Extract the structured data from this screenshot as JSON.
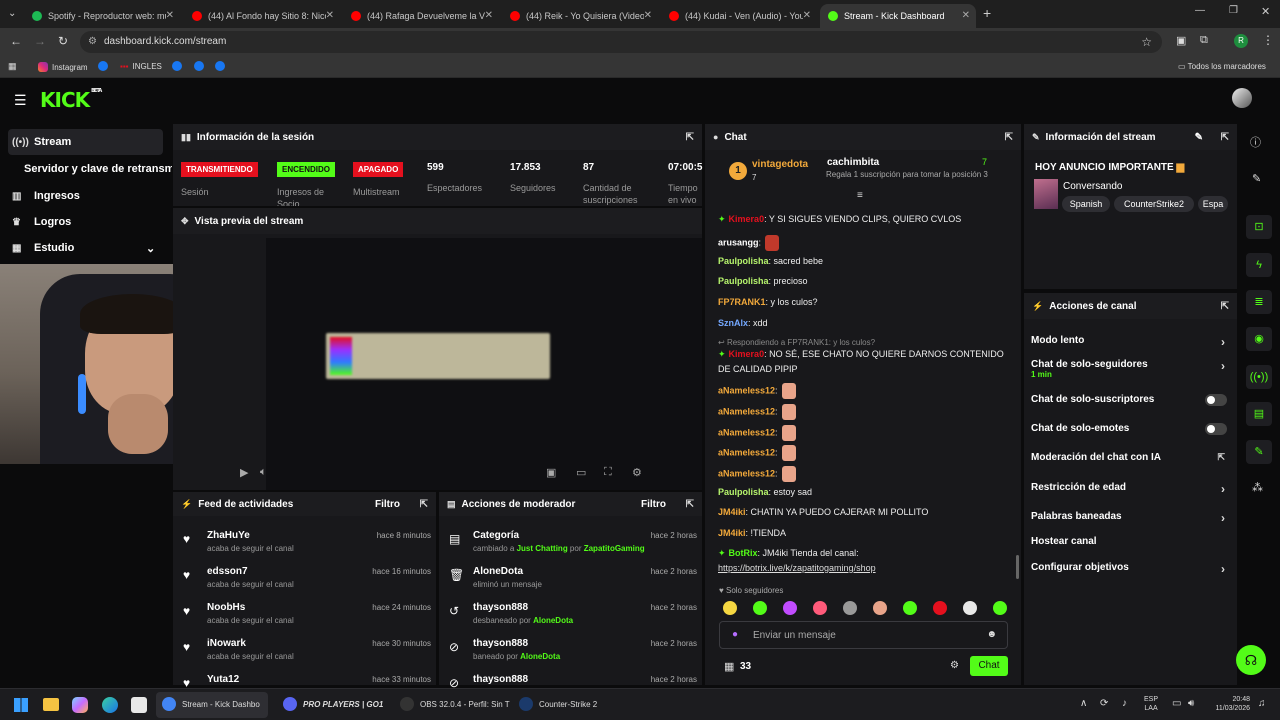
{
  "browser": {
    "tabs": [
      {
        "label": "Spotify - Reproductor web: mú",
        "color": "#1db954"
      },
      {
        "label": "(44) Al Fondo hay Sitio 8: Nicol",
        "color": "#ff0000"
      },
      {
        "label": "(44) Rafaga Devuelveme la Vida",
        "color": "#ff0000"
      },
      {
        "label": "(44) Reik - Yo Quisiera (Video) ",
        "color": "#ff0000"
      },
      {
        "label": "(44) Kudai - Ven (Audio) - YouTu",
        "color": "#ff0000"
      },
      {
        "label": "Stream - Kick Dashboard",
        "color": "#53fc18"
      }
    ],
    "url": "dashboard.kick.com/stream",
    "bookmarks": [
      "Instagram",
      "INGLES"
    ],
    "all_bookmarks": "Todos los marcadores",
    "profile_letter": "R"
  },
  "kick": {
    "logo": "KICK",
    "beta": "BETA"
  },
  "nav": {
    "stream": "Stream",
    "server": "Servidor y clave de retransm",
    "ingresos": "Ingresos",
    "logros": "Logros",
    "estudio": "Estudio"
  },
  "session": {
    "title": "Información de la sesión",
    "badges": [
      {
        "label": "TRANSMITIENDO",
        "caption": "Sesión",
        "color": "#e5101e"
      },
      {
        "label": "ENCENDIDO",
        "caption": "Ingresos de Socio",
        "color": "#53fc18"
      },
      {
        "label": "APAGADO",
        "caption": "Multistream",
        "color": "#e5101e"
      }
    ],
    "stats": [
      {
        "value": "599",
        "label": "Espectadores"
      },
      {
        "value": "17.853",
        "label": "Seguidores"
      },
      {
        "value": "87",
        "label": "Cantidad de suscripciones"
      },
      {
        "value": "07:00:5",
        "label": "Tiempo en vivo"
      }
    ]
  },
  "preview": {
    "title": "Vista previa del stream"
  },
  "feed": {
    "title": "Feed de actividades",
    "filter": "Filtro",
    "items": [
      {
        "name": "ZhaHuYe",
        "sub": "acaba de seguir el canal",
        "time": "hace 8 minutos"
      },
      {
        "name": "edsson7",
        "sub": "acaba de seguir el canal",
        "time": "hace 16 minutos"
      },
      {
        "name": "NoobHs",
        "sub": "acaba de seguir el canal",
        "time": "hace 24 minutos"
      },
      {
        "name": "iNowark",
        "sub": "acaba de seguir el canal",
        "time": "hace 30 minutos"
      },
      {
        "name": "Yuta12",
        "sub": "",
        "time": "hace 33 minutos"
      }
    ]
  },
  "mod": {
    "title": "Acciones de moderador",
    "filter": "Filtro",
    "items": [
      {
        "name": "Categoría",
        "pre": "cambiado a ",
        "h1": "Just Chatting",
        "mid": " por ",
        "h2": "ZapatitoGaming",
        "time": "hace 2 horas",
        "icon": "category"
      },
      {
        "name": "AloneDota",
        "pre": "eliminó un mensaje",
        "h1": "",
        "mid": "",
        "h2": "",
        "time": "hace 2 horas",
        "icon": "trash"
      },
      {
        "name": "thayson888",
        "pre": "desbaneado por ",
        "h1": "AloneDota",
        "mid": "",
        "h2": "",
        "time": "hace 2 horas",
        "icon": "unban"
      },
      {
        "name": "thayson888",
        "pre": "baneado por ",
        "h1": "AloneDota",
        "mid": "",
        "h2": "",
        "time": "hace 2 horas",
        "icon": "ban"
      },
      {
        "name": "thayson888",
        "pre": "",
        "h1": "",
        "mid": "",
        "h2": "",
        "time": "hace 2 horas",
        "icon": "ban"
      }
    ]
  },
  "chat": {
    "title": "Chat",
    "gifter1": {
      "name": "vintagedota",
      "count": "7"
    },
    "gifter2": {
      "name": "cachimbita",
      "count": "7",
      "note": "Regala 1 suscripción para tomar la posición 3"
    },
    "messages": [
      {
        "user": "Kimera0",
        "color": "#e5101e",
        "text": ": Y SI SIGUES VIENDO CLIPS, QUIERO CVLOS"
      },
      {
        "user": "arusangg",
        "color": "#ffffff",
        "text": ":"
      },
      {
        "user": "Paulpolisha",
        "color": "#b7f56d",
        "text": ": sacred bebe"
      },
      {
        "user": "Paulpolisha",
        "color": "#b7f56d",
        "text": ": precioso"
      },
      {
        "user": "FP7RANK1",
        "color": "#f2a93b",
        "text": ": y los culos?"
      },
      {
        "user": "SznAlx",
        "color": "#74a8ff",
        "text": ": xdd"
      },
      {
        "user": "Kimera0",
        "color": "#e5101e",
        "text": ": NO SÉ, ESE CHATO NO QUIERE DARNOS CONTENIDO"
      },
      {
        "user": "aNameless12",
        "color": "#f2a93b",
        "text": ":"
      },
      {
        "user": "aNameless12",
        "color": "#f2a93b",
        "text": ":"
      },
      {
        "user": "aNameless12",
        "color": "#f2a93b",
        "text": ":"
      },
      {
        "user": "aNameless12",
        "color": "#f2a93b",
        "text": ":"
      },
      {
        "user": "aNameless12",
        "color": "#f2a93b",
        "text": ":"
      },
      {
        "user": "Paulpolisha",
        "color": "#b7f56d",
        "text": ": estoy sad"
      },
      {
        "user": "JM4iki",
        "color": "#f2a93b",
        "text": ": CHATIN YA PUEDO CAJERAR MI POLLITO"
      },
      {
        "user": "JM4iki",
        "color": "#f2a93b",
        "text": ": !TIENDA"
      },
      {
        "user": "BotRix",
        "color": "#53fc18",
        "text": ": JM4iki Tienda del canal:"
      }
    ],
    "reply_note": "Respondiendo a FP7RANK1: y los culos?",
    "kimera_cont": "DE CALIDAD PIPIP",
    "botrix_link": "https://botrix.live/k/zapatitogaming/shop",
    "followers_only": "Solo seguidores",
    "input_placeholder": "Enviar un mensaje",
    "points": "33",
    "send": "Chat"
  },
  "info": {
    "title": "Información del stream",
    "stream_title": "HOY ANUNCIO IMPORTANTE",
    "category": "Conversando",
    "tags": [
      "Spanish",
      "CounterStrike2",
      "Espa"
    ]
  },
  "actions": {
    "title": "Acciones de canal",
    "rows": [
      {
        "label": "Modo lento",
        "kind": "chev",
        "sub": ""
      },
      {
        "label": "Chat de solo-seguidores",
        "kind": "chev",
        "sub": "1 min"
      },
      {
        "label": "Chat de solo-suscriptores",
        "kind": "toggle",
        "sub": ""
      },
      {
        "label": "Chat de solo-emotes",
        "kind": "toggle",
        "sub": ""
      },
      {
        "label": "Moderación del chat con IA",
        "kind": "ext",
        "sub": ""
      },
      {
        "label": "Restricción de edad",
        "kind": "chev",
        "sub": ""
      },
      {
        "label": "Palabras baneadas",
        "kind": "chev",
        "sub": ""
      },
      {
        "label": "Hostear canal",
        "kind": "none",
        "sub": ""
      },
      {
        "label": "Configurar objetivos",
        "kind": "chev",
        "sub": ""
      }
    ]
  },
  "taskbar": {
    "apps": [
      {
        "label": "Stream - Kick Dashbo",
        "color": "#4285f4"
      },
      {
        "label": "PRO PLAYERS | GO1",
        "color": "#5865f2"
      },
      {
        "label": "OBS 32.0.4 - Perfil: Sin T",
        "color": "#333333"
      },
      {
        "label": "Counter-Strike 2",
        "color": "#1b3a6b"
      }
    ],
    "lang1": "ESP",
    "lang2": "LAA",
    "time": "20:48",
    "date": "11/03/2026"
  }
}
